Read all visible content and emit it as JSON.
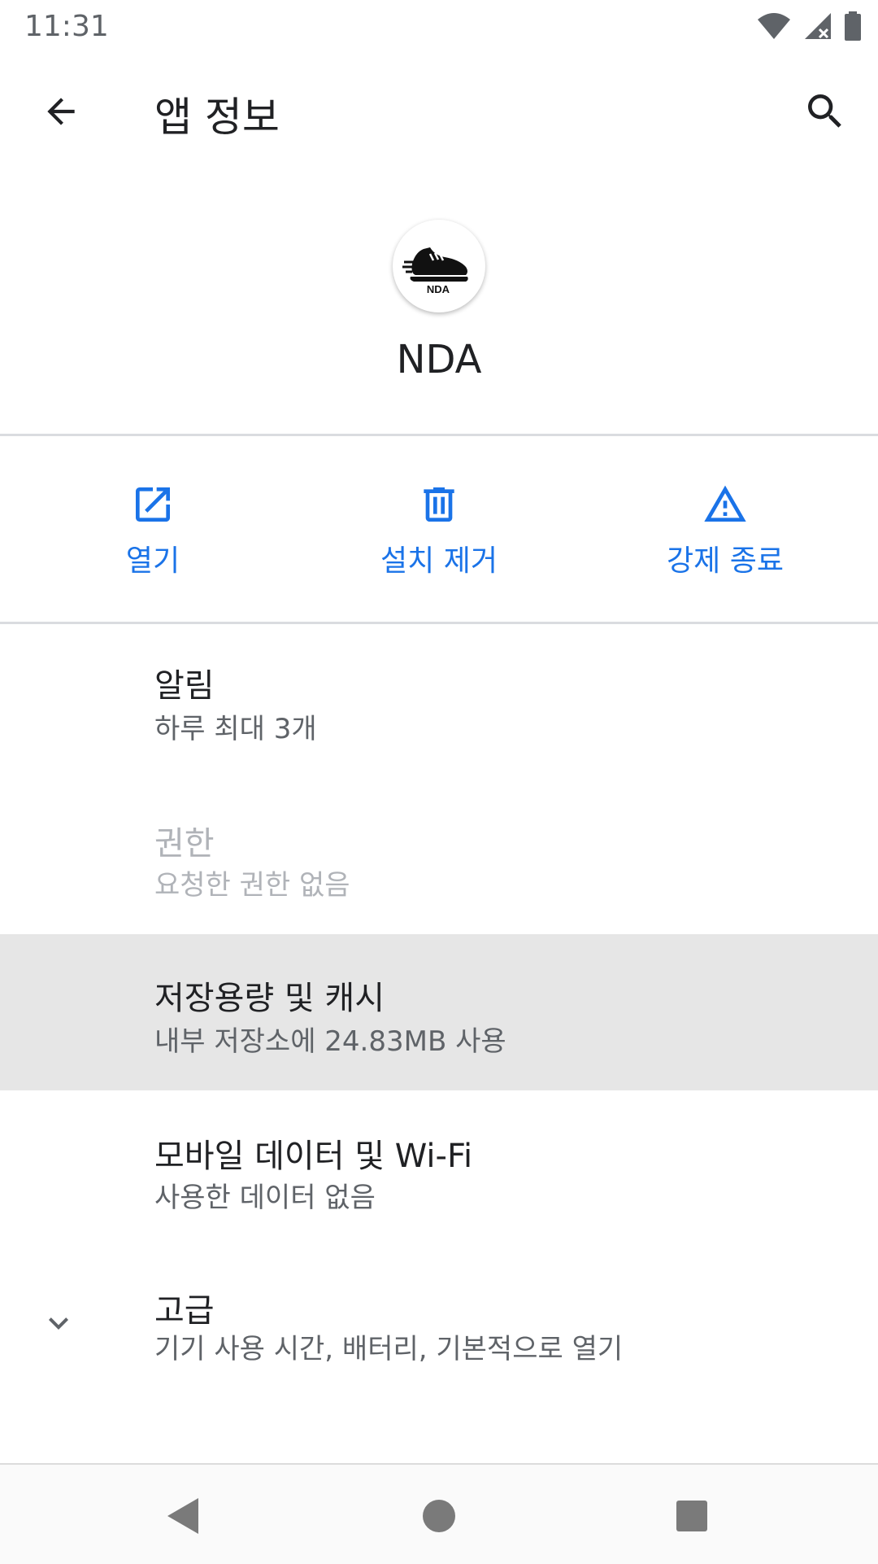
{
  "status_bar": {
    "time": "11:31",
    "icons": [
      "wifi-icon",
      "signal-icon",
      "battery-icon"
    ]
  },
  "app_bar": {
    "title": "앱 정보",
    "back_icon": "arrow-back-icon",
    "search_icon": "search-icon"
  },
  "app": {
    "name": "NDA",
    "icon_text": "NDA"
  },
  "actions": [
    {
      "label": "열기",
      "icon": "open-external-icon"
    },
    {
      "label": "설치 제거",
      "icon": "trash-icon"
    },
    {
      "label": "강제 종료",
      "icon": "warning-icon"
    }
  ],
  "settings": [
    {
      "title": "알림",
      "subtitle": "하루 최대 3개",
      "state": "enabled"
    },
    {
      "title": "권한",
      "subtitle": "요청한 권한 없음",
      "state": "disabled"
    },
    {
      "title": "저장용량 및 캐시",
      "subtitle": "내부 저장소에 24.83MB 사용",
      "state": "highlighted"
    },
    {
      "title": "모바일 데이터 및 Wi-Fi",
      "subtitle": "사용한 데이터 없음",
      "state": "enabled"
    },
    {
      "title": "고급",
      "subtitle": "기기 사용 시간, 배터리, 기본적으로 열기",
      "state": "collapsed"
    }
  ],
  "nav_bar": {
    "buttons": [
      "back-triangle-icon",
      "home-circle-icon",
      "recents-square-icon"
    ]
  },
  "colors": {
    "accent": "#1a73e8",
    "highlight_row": "#e6e6e6",
    "divider": "#dadce0"
  }
}
